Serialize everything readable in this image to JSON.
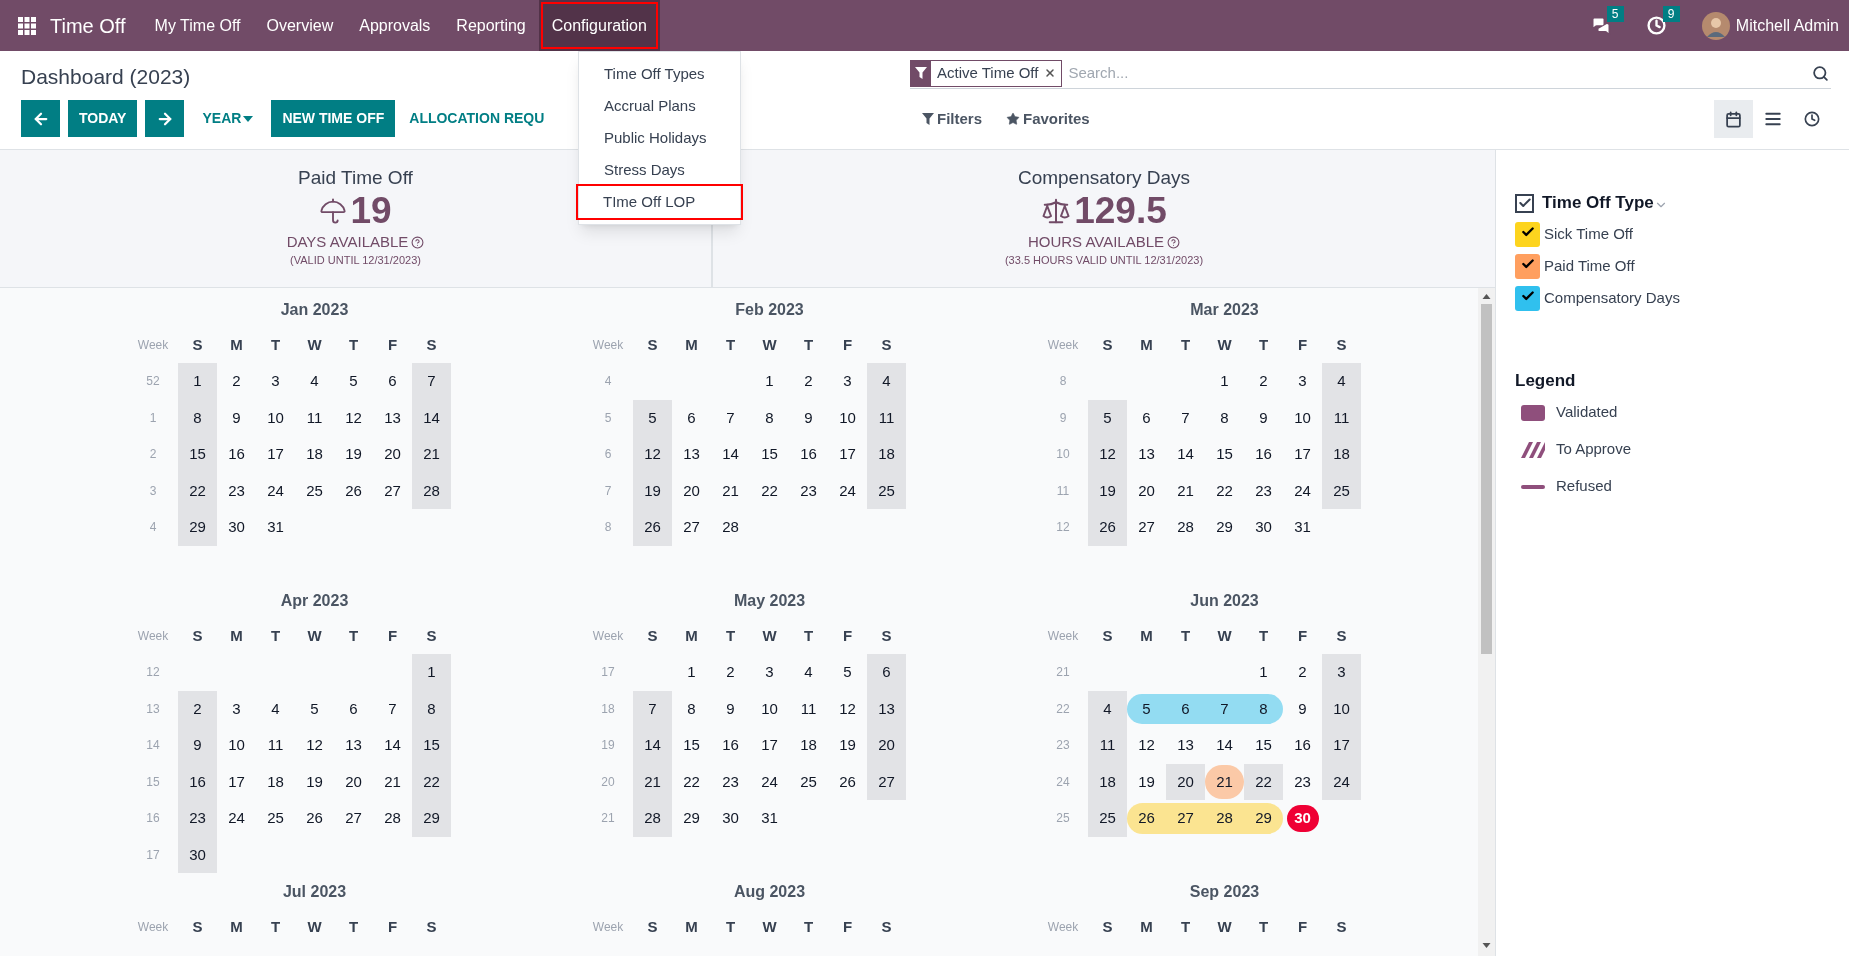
{
  "top_bar": {
    "app_name": "Time Off",
    "menu": [
      {
        "label": "My Time Off",
        "open": false,
        "annotated": false
      },
      {
        "label": "Overview",
        "open": false,
        "annotated": false
      },
      {
        "label": "Approvals",
        "open": false,
        "annotated": false
      },
      {
        "label": "Reporting",
        "open": false,
        "annotated": false
      },
      {
        "label": "Configuration",
        "open": true,
        "annotated": true
      }
    ],
    "messages_badge": "5",
    "activities_badge": "9",
    "user": "Mitchell Admin"
  },
  "configuration_menu": {
    "items": [
      {
        "label": "Time Off Types",
        "annotated": false
      },
      {
        "label": "Accrual Plans",
        "annotated": false
      },
      {
        "label": "Public Holidays",
        "annotated": false
      },
      {
        "label": "Stress Days",
        "annotated": false
      },
      {
        "label": "TIme Off LOP",
        "annotated": true
      }
    ]
  },
  "control_panel": {
    "title": "Dashboard (2023)",
    "buttons": [
      {
        "kind": "prev"
      },
      {
        "kind": "primary",
        "label": "TODAY"
      },
      {
        "kind": "next"
      },
      {
        "kind": "dropdown",
        "label": "YEAR"
      },
      {
        "kind": "primary",
        "label": "NEW TIME OFF"
      },
      {
        "kind": "link",
        "label": "ALLOCATION REQU"
      }
    ],
    "search": {
      "facet": "Active Time Off",
      "placeholder": "Search..."
    },
    "filters": "Filters",
    "favorites": "Favorites",
    "views": [
      {
        "kind": "calendar",
        "selected": true
      },
      {
        "kind": "list",
        "selected": false
      },
      {
        "kind": "activity",
        "selected": false
      }
    ]
  },
  "summary": [
    {
      "kind": "paid",
      "title": "Paid Time Off",
      "value": "19",
      "unit": "DAYS AVAILABLE",
      "note": "(VALID UNTIL 12/31/2023)"
    },
    {
      "kind": "compensatory",
      "title": "Compensatory Days",
      "value": "129.5",
      "unit": "HOURS AVAILABLE",
      "note": "(33.5 HOURS VALID UNTIL 12/31/2023)"
    }
  ],
  "months": [
    {
      "title": "Jan 2023",
      "week_label": "Week",
      "weekdays": [
        "S",
        "M",
        "T",
        "W",
        "T",
        "F",
        "S"
      ],
      "weeks": [
        {
          "number": "52",
          "days": {
            "sun": "1",
            "mon": "2",
            "tue": "3",
            "wed": "4",
            "thu": "5",
            "fri": "6",
            "sat": "7"
          }
        },
        {
          "number": "1",
          "days": {
            "sun": "8",
            "mon": "9",
            "tue": "10",
            "wed": "11",
            "thu": "12",
            "fri": "13",
            "sat": "14"
          }
        },
        {
          "number": "2",
          "days": {
            "sun": "15",
            "mon": "16",
            "tue": "17",
            "wed": "18",
            "thu": "19",
            "fri": "20",
            "sat": "21"
          }
        },
        {
          "number": "3",
          "days": {
            "sun": "22",
            "mon": "23",
            "tue": "24",
            "wed": "25",
            "thu": "26",
            "fri": "27",
            "sat": "28"
          }
        },
        {
          "number": "4",
          "days": {
            "sun": "29",
            "mon": "30",
            "tue": "31"
          }
        }
      ]
    },
    {
      "title": "Feb 2023",
      "week_label": "Week",
      "weekdays": [
        "S",
        "M",
        "T",
        "W",
        "T",
        "F",
        "S"
      ],
      "weeks": [
        {
          "number": "4",
          "days": {
            "wed": "1",
            "thu": "2",
            "fri": "3",
            "sat": "4"
          }
        },
        {
          "number": "5",
          "days": {
            "sun": "5",
            "mon": "6",
            "tue": "7",
            "wed": "8",
            "thu": "9",
            "fri": "10",
            "sat": "11"
          }
        },
        {
          "number": "6",
          "days": {
            "sun": "12",
            "mon": "13",
            "tue": "14",
            "wed": "15",
            "thu": "16",
            "fri": "17",
            "sat": "18"
          }
        },
        {
          "number": "7",
          "days": {
            "sun": "19",
            "mon": "20",
            "tue": "21",
            "wed": "22",
            "thu": "23",
            "fri": "24",
            "sat": "25"
          }
        },
        {
          "number": "8",
          "days": {
            "sun": "26",
            "mon": "27",
            "tue": "28"
          }
        }
      ]
    },
    {
      "title": "Mar 2023",
      "week_label": "Week",
      "weekdays": [
        "S",
        "M",
        "T",
        "W",
        "T",
        "F",
        "S"
      ],
      "weeks": [
        {
          "number": "8",
          "days": {
            "wed": "1",
            "thu": "2",
            "fri": "3",
            "sat": "4"
          }
        },
        {
          "number": "9",
          "days": {
            "sun": "5",
            "mon": "6",
            "tue": "7",
            "wed": "8",
            "thu": "9",
            "fri": "10",
            "sat": "11"
          }
        },
        {
          "number": "10",
          "days": {
            "sun": "12",
            "mon": "13",
            "tue": "14",
            "wed": "15",
            "thu": "16",
            "fri": "17",
            "sat": "18"
          }
        },
        {
          "number": "11",
          "days": {
            "sun": "19",
            "mon": "20",
            "tue": "21",
            "wed": "22",
            "thu": "23",
            "fri": "24",
            "sat": "25"
          }
        },
        {
          "number": "12",
          "days": {
            "sun": "26",
            "mon": "27",
            "tue": "28",
            "wed": "29",
            "thu": "30",
            "fri": "31"
          }
        }
      ]
    },
    {
      "title": "Apr 2023",
      "week_label": "Week",
      "weekdays": [
        "S",
        "M",
        "T",
        "W",
        "T",
        "F",
        "S"
      ],
      "weeks": [
        {
          "number": "12",
          "days": {
            "sat": "1"
          }
        },
        {
          "number": "13",
          "days": {
            "sun": "2",
            "mon": "3",
            "tue": "4",
            "wed": "5",
            "thu": "6",
            "fri": "7",
            "sat": "8"
          }
        },
        {
          "number": "14",
          "days": {
            "sun": "9",
            "mon": "10",
            "tue": "11",
            "wed": "12",
            "thu": "13",
            "fri": "14",
            "sat": "15"
          }
        },
        {
          "number": "15",
          "days": {
            "sun": "16",
            "mon": "17",
            "tue": "18",
            "wed": "19",
            "thu": "20",
            "fri": "21",
            "sat": "22"
          }
        },
        {
          "number": "16",
          "days": {
            "sun": "23",
            "mon": "24",
            "tue": "25",
            "wed": "26",
            "thu": "27",
            "fri": "28",
            "sat": "29"
          }
        },
        {
          "number": "17",
          "days": {
            "sun": "30"
          }
        }
      ]
    },
    {
      "title": "May 2023",
      "week_label": "Week",
      "weekdays": [
        "S",
        "M",
        "T",
        "W",
        "T",
        "F",
        "S"
      ],
      "weeks": [
        {
          "number": "17",
          "days": {
            "mon": "1",
            "tue": "2",
            "wed": "3",
            "thu": "4",
            "fri": "5",
            "sat": "6"
          }
        },
        {
          "number": "18",
          "days": {
            "sun": "7",
            "mon": "8",
            "tue": "9",
            "wed": "10",
            "thu": "11",
            "fri": "12",
            "sat": "13"
          }
        },
        {
          "number": "19",
          "days": {
            "sun": "14",
            "mon": "15",
            "tue": "16",
            "wed": "17",
            "thu": "18",
            "fri": "19",
            "sat": "20"
          }
        },
        {
          "number": "20",
          "days": {
            "sun": "21",
            "mon": "22",
            "tue": "23",
            "wed": "24",
            "thu": "25",
            "fri": "26",
            "sat": "27"
          }
        },
        {
          "number": "21",
          "days": {
            "sun": "28",
            "mon": "29",
            "tue": "30",
            "wed": "31"
          }
        }
      ]
    },
    {
      "title": "Jun 2023",
      "week_label": "Week",
      "weekdays": [
        "S",
        "M",
        "T",
        "W",
        "T",
        "F",
        "S"
      ],
      "weeks": [
        {
          "number": "21",
          "days": {
            "thu": "1",
            "fri": "2",
            "sat": "3"
          }
        },
        {
          "number": "22",
          "days": {
            "sun": "4",
            "mon": {
              "d": "5",
              "kind": "compensatory"
            },
            "tue": {
              "d": "6",
              "kind": "compensatory"
            },
            "wed": {
              "d": "7",
              "kind": "compensatory"
            },
            "thu": {
              "d": "8",
              "kind": "compensatory"
            },
            "fri": "9",
            "sat": "10"
          }
        },
        {
          "number": "23",
          "days": {
            "sun": "11",
            "mon": "12",
            "tue": "13",
            "wed": "14",
            "thu": "15",
            "fri": "16",
            "sat": "17"
          }
        },
        {
          "number": "24",
          "days": {
            "sun": "18",
            "mon": "19",
            "tue": {
              "d": "20",
              "kind": "holiday"
            },
            "wed": {
              "d": "21",
              "kind": "paid"
            },
            "thu": {
              "d": "22",
              "kind": "holiday"
            },
            "fri": "23",
            "sat": "24"
          }
        },
        {
          "number": "25",
          "days": {
            "sun": "25",
            "mon": {
              "d": "26",
              "kind": "sick"
            },
            "tue": {
              "d": "27",
              "kind": "sick"
            },
            "wed": {
              "d": "28",
              "kind": "sick"
            },
            "thu": {
              "d": "29",
              "kind": "sick"
            },
            "fri": {
              "d": "30",
              "kind": "today"
            }
          }
        }
      ]
    },
    {
      "title": "Jul 2023",
      "week_label": "Week",
      "weekdays": [
        "S",
        "M",
        "T",
        "W",
        "T",
        "F",
        "S"
      ]
    },
    {
      "title": "Aug 2023",
      "week_label": "Week",
      "weekdays": [
        "S",
        "M",
        "T",
        "W",
        "T",
        "F",
        "S"
      ]
    },
    {
      "title": "Sep 2023",
      "week_label": "Week",
      "weekdays": [
        "S",
        "M",
        "T",
        "W",
        "T",
        "F",
        "S"
      ]
    }
  ],
  "sidebar": {
    "filter": {
      "title": "Time Off Type",
      "checked": true,
      "items": [
        {
          "label": "Sick Time Off",
          "color": "#fdd41e",
          "checked": true
        },
        {
          "label": "Paid Time Off",
          "color": "#ff9f5f",
          "checked": true
        },
        {
          "label": "Compensatory Days",
          "color": "#30c0ee",
          "checked": true
        }
      ]
    },
    "legend": {
      "title": "Legend",
      "items": [
        {
          "kind": "validated",
          "label": "Validated"
        },
        {
          "kind": "to_approve",
          "label": "To Approve"
        },
        {
          "kind": "refused",
          "label": "Refused"
        }
      ]
    }
  }
}
